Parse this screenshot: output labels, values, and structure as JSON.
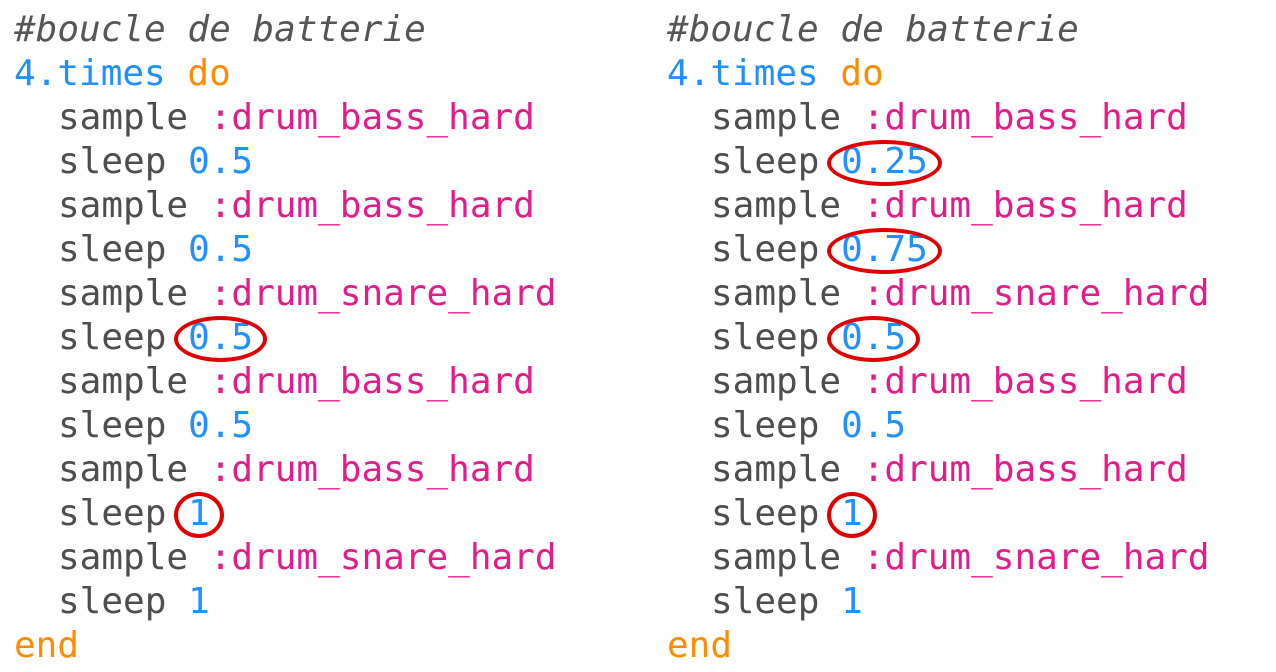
{
  "panels": [
    {
      "id": "left",
      "comment": "#boucle de batterie",
      "loop": {
        "count": "4",
        "method": ".times",
        "keyword": "do"
      },
      "lines": [
        {
          "command": "sample",
          "arg": ":drum_bass_hard",
          "arg_type": "symbol",
          "circled": false
        },
        {
          "command": "sleep",
          "arg": "0.5",
          "arg_type": "number",
          "circled": false
        },
        {
          "command": "sample",
          "arg": ":drum_bass_hard",
          "arg_type": "symbol",
          "circled": false
        },
        {
          "command": "sleep",
          "arg": "0.5",
          "arg_type": "number",
          "circled": false
        },
        {
          "command": "sample",
          "arg": ":drum_snare_hard",
          "arg_type": "symbol",
          "circled": false
        },
        {
          "command": "sleep",
          "arg": "0.5",
          "arg_type": "number",
          "circled": true
        },
        {
          "command": "sample",
          "arg": ":drum_bass_hard",
          "arg_type": "symbol",
          "circled": false
        },
        {
          "command": "sleep",
          "arg": "0.5",
          "arg_type": "number",
          "circled": false
        },
        {
          "command": "sample",
          "arg": ":drum_bass_hard",
          "arg_type": "symbol",
          "circled": false
        },
        {
          "command": "sleep",
          "arg": "1",
          "arg_type": "number",
          "circled": true
        },
        {
          "command": "sample",
          "arg": ":drum_snare_hard",
          "arg_type": "symbol",
          "circled": false
        },
        {
          "command": "sleep",
          "arg": "1",
          "arg_type": "number",
          "circled": false
        }
      ],
      "end": "end"
    },
    {
      "id": "right",
      "comment": "#boucle de batterie",
      "loop": {
        "count": "4",
        "method": ".times",
        "keyword": "do"
      },
      "lines": [
        {
          "command": "sample",
          "arg": ":drum_bass_hard",
          "arg_type": "symbol",
          "circled": false
        },
        {
          "command": "sleep",
          "arg": "0.25",
          "arg_type": "number",
          "circled": true
        },
        {
          "command": "sample",
          "arg": ":drum_bass_hard",
          "arg_type": "symbol",
          "circled": false
        },
        {
          "command": "sleep",
          "arg": "0.75",
          "arg_type": "number",
          "circled": true
        },
        {
          "command": "sample",
          "arg": ":drum_snare_hard",
          "arg_type": "symbol",
          "circled": false
        },
        {
          "command": "sleep",
          "arg": "0.5",
          "arg_type": "number",
          "circled": true
        },
        {
          "command": "sample",
          "arg": ":drum_bass_hard",
          "arg_type": "symbol",
          "circled": false
        },
        {
          "command": "sleep",
          "arg": "0.5",
          "arg_type": "number",
          "circled": false
        },
        {
          "command": "sample",
          "arg": ":drum_bass_hard",
          "arg_type": "symbol",
          "circled": false
        },
        {
          "command": "sleep",
          "arg": "1",
          "arg_type": "number",
          "circled": true
        },
        {
          "command": "sample",
          "arg": ":drum_snare_hard",
          "arg_type": "symbol",
          "circled": false
        },
        {
          "command": "sleep",
          "arg": "1",
          "arg_type": "number",
          "circled": false
        }
      ],
      "end": "end"
    }
  ],
  "colors": {
    "comment": "#555555",
    "number": "#1e90ff",
    "keyword": "#ff8c00",
    "symbol": "#e8198b",
    "command": "#4d4d4d",
    "highlight_circle": "#e00000"
  }
}
